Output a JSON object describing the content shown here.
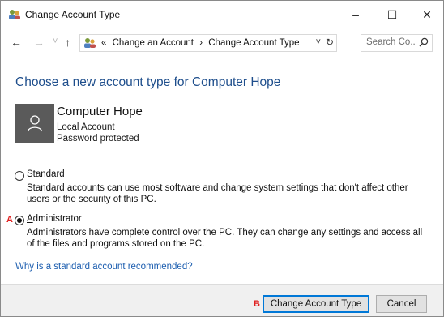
{
  "window": {
    "title": "Change Account Type",
    "minimize": "–",
    "maximize": "☐",
    "close": "✕"
  },
  "nav": {
    "back": "←",
    "forward": "→",
    "recent": "˅",
    "up": "↑",
    "crumb_prefix": "«",
    "breadcrumbs": [
      "Change an Account",
      "Change Account Type"
    ],
    "separator": "›",
    "dropdown": "˅",
    "refresh": "↻",
    "search_placeholder": "Search Co..."
  },
  "main": {
    "heading": "Choose a new account type for Computer Hope",
    "user": {
      "name": "Computer Hope",
      "type": "Local Account",
      "status": "Password protected"
    },
    "options": [
      {
        "label": "Standard",
        "selected": false,
        "description": "Standard accounts can use most software and change system settings that don't affect other users or the security of this PC."
      },
      {
        "label": "Administrator",
        "selected": true,
        "marker": "A",
        "description": "Administrators have complete control over the PC. They can change any settings and access all of the files and programs stored on the PC."
      }
    ],
    "help_link": "Why is a standard account recommended?"
  },
  "footer": {
    "marker": "B",
    "primary_button": "Change Account Type",
    "cancel_button": "Cancel"
  },
  "colors": {
    "heading": "#1e4e8c",
    "link": "#1e5fb0",
    "marker": "#e02020",
    "avatar_bg": "#5a5a5a",
    "button_focus": "#0078d7"
  }
}
